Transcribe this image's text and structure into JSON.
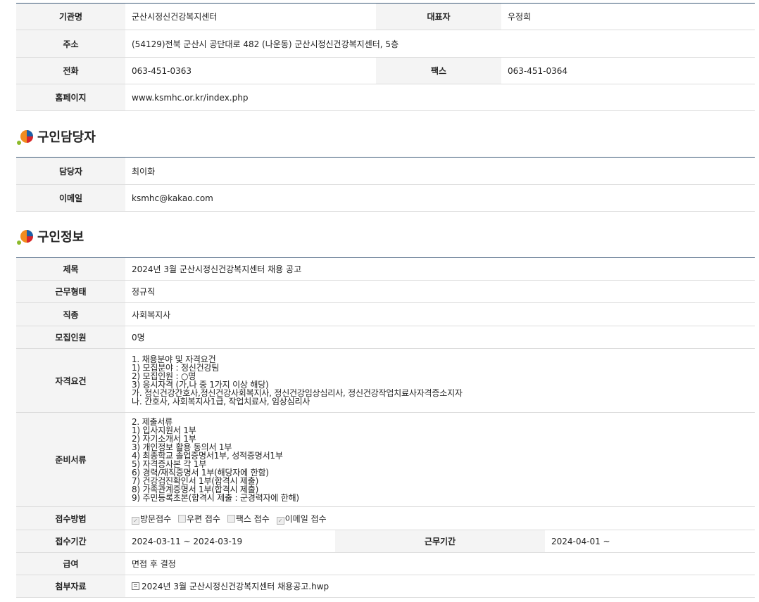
{
  "org": {
    "name_label": "기관명",
    "name": "군산시정신건강복지센터",
    "rep_label": "대표자",
    "rep": "우정희",
    "addr_label": "주소",
    "addr": "(54129)전북 군산시 공단대로 482 (나운동) 군산시정신건강복지센터, 5층",
    "tel_label": "전화",
    "tel": "063-451-0363",
    "fax_label": "팩스",
    "fax": "063-451-0364",
    "home_label": "홈페이지",
    "home": "www.ksmhc.or.kr/index.php"
  },
  "contact": {
    "title": "구인담당자",
    "person_label": "담당자",
    "person": "최이화",
    "email_label": "이메일",
    "email": "ksmhc@kakao.com"
  },
  "job": {
    "title": "구인정보",
    "subject_label": "제목",
    "subject": "2024년 3월 군산시정신건강복지센터 채용 공고",
    "type_label": "근무형태",
    "type": "정규직",
    "field_label": "직종",
    "field": "사회복지사",
    "count_label": "모집인원",
    "count": "0명",
    "qual_label": "자격요건",
    "qual_lines": [
      "1. 채용분야 및 자격요건",
      "1) 모집분야 : 정신건강팀",
      "2) 모집인원 : ○명",
      "3) 응시자격 (가,나 중 1가지 이상 해당)",
      "가. 정신건강간호사,정신건강사회복지사, 정신건강임상심리사, 정신건강작업치료사자격증소지자",
      "나. 간호사, 사회복지사1급, 작업치료사, 임상심리사"
    ],
    "docs_label": "준비서류",
    "docs_lines": [
      "2. 제출서류",
      "1) 입사지원서 1부",
      "2) 자기소개서 1부",
      "3) 개인정보 활용 동의서 1부",
      "4) 최종학교 졸업증명서1부, 성적증명서1부",
      "5) 자격증사본 각 1부",
      "6) 경력/재직증명서 1부(해당자에 한함)",
      "7) 건강검진확인서 1부(합격시 제출)",
      "8) 가족관계증명서 1부(합격시 제출)",
      "9) 주민등록초본(합격시 제출 : 군경력자에 한해)"
    ],
    "method_label": "접수방법",
    "methods": [
      {
        "label": "방문접수",
        "checked": true
      },
      {
        "label": "우편 접수",
        "checked": false
      },
      {
        "label": "팩스 접수",
        "checked": false
      },
      {
        "label": "이메일 접수",
        "checked": true
      }
    ],
    "period_label": "접수기간",
    "period": "2024-03-11 ~ 2024-03-19",
    "workperiod_label": "근무기간",
    "workperiod": "2024-04-01 ~",
    "salary_label": "급여",
    "salary": "면접 후 결정",
    "attach_label": "첨부자료",
    "attach": "2024년 3월 군산시정신건강복지센터 채용공고.hwp"
  }
}
